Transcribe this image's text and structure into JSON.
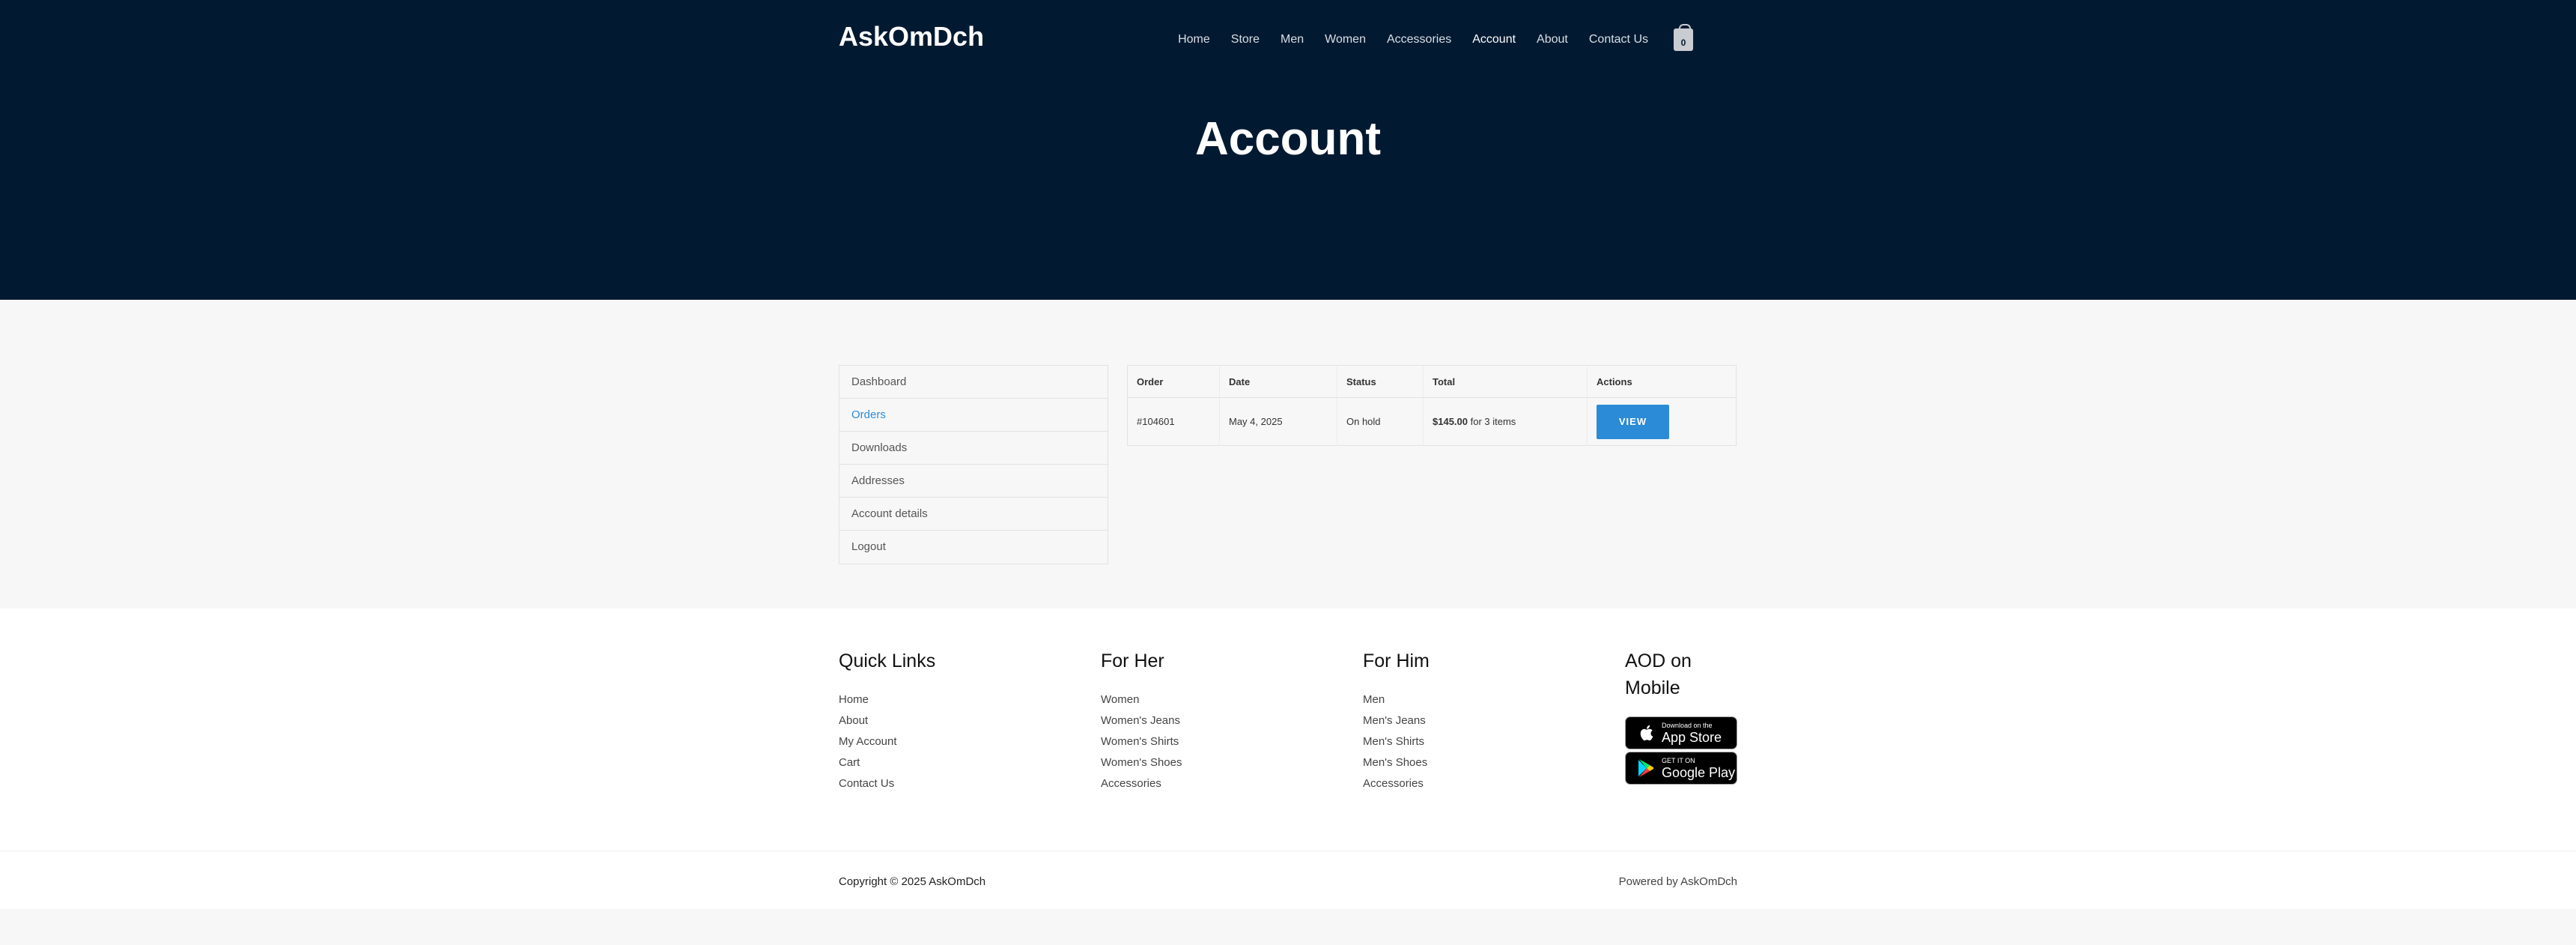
{
  "brand": "AskOmDch",
  "nav": [
    "Home",
    "Store",
    "Men",
    "Women",
    "Accessories",
    "Account",
    "About",
    "Contact Us"
  ],
  "nav_active": "Account",
  "cart_count": "0",
  "page_title": "Account",
  "account_nav": [
    "Dashboard",
    "Orders",
    "Downloads",
    "Addresses",
    "Account details",
    "Logout"
  ],
  "account_nav_active": "Orders",
  "orders": {
    "headers": [
      "Order",
      "Date",
      "Status",
      "Total",
      "Actions"
    ],
    "rows": [
      {
        "order": "#104601",
        "date": "May 4, 2025",
        "status": "On hold",
        "total_amount": "$145.00",
        "total_items": " for 3 items",
        "action": "VIEW"
      }
    ]
  },
  "footer": {
    "quick_links": {
      "title": "Quick Links",
      "links": [
        "Home",
        "About",
        "My Account",
        "Cart",
        "Contact Us"
      ]
    },
    "for_her": {
      "title": "For Her",
      "links": [
        "Women",
        "Women's Jeans",
        "Women's Shirts",
        "Women's Shoes",
        "Accessories"
      ]
    },
    "for_him": {
      "title": "For Him",
      "links": [
        "Men",
        "Men's Jeans",
        "Men's Shirts",
        "Men's Shoes",
        "Accessories"
      ]
    },
    "mobile": {
      "title": "AOD on Mobile",
      "app_store_small": "Download on the",
      "app_store_big": "App Store",
      "google_small": "GET IT ON",
      "google_big": "Google Play"
    }
  },
  "copyright": "Copyright © 2025 AskOmDch",
  "powered": "Powered by AskOmDch",
  "colors": {
    "header_bg": "#021a31",
    "accent": "#2b8bd6"
  }
}
